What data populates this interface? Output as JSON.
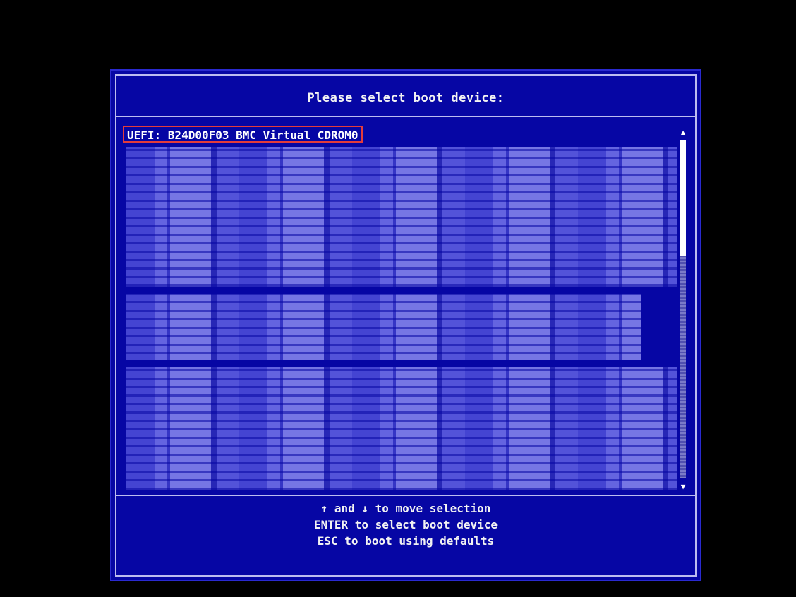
{
  "dialog": {
    "title": "Please select boot device:",
    "selected_device": "UEFI: B24D00F03 BMC Virtual CDROM0",
    "help_lines": [
      "↑ and ↓ to move selection",
      "ENTER to select boot device",
      "ESC to boot using defaults"
    ]
  },
  "scrollbar": {
    "up_icon": "▲",
    "down_icon": "▼"
  },
  "colors": {
    "background": "#000000",
    "dialog_blue": "#0606a4",
    "frame": "#bcbcf0",
    "selection_border": "#e23c3c",
    "text": "#f2f2f2"
  }
}
